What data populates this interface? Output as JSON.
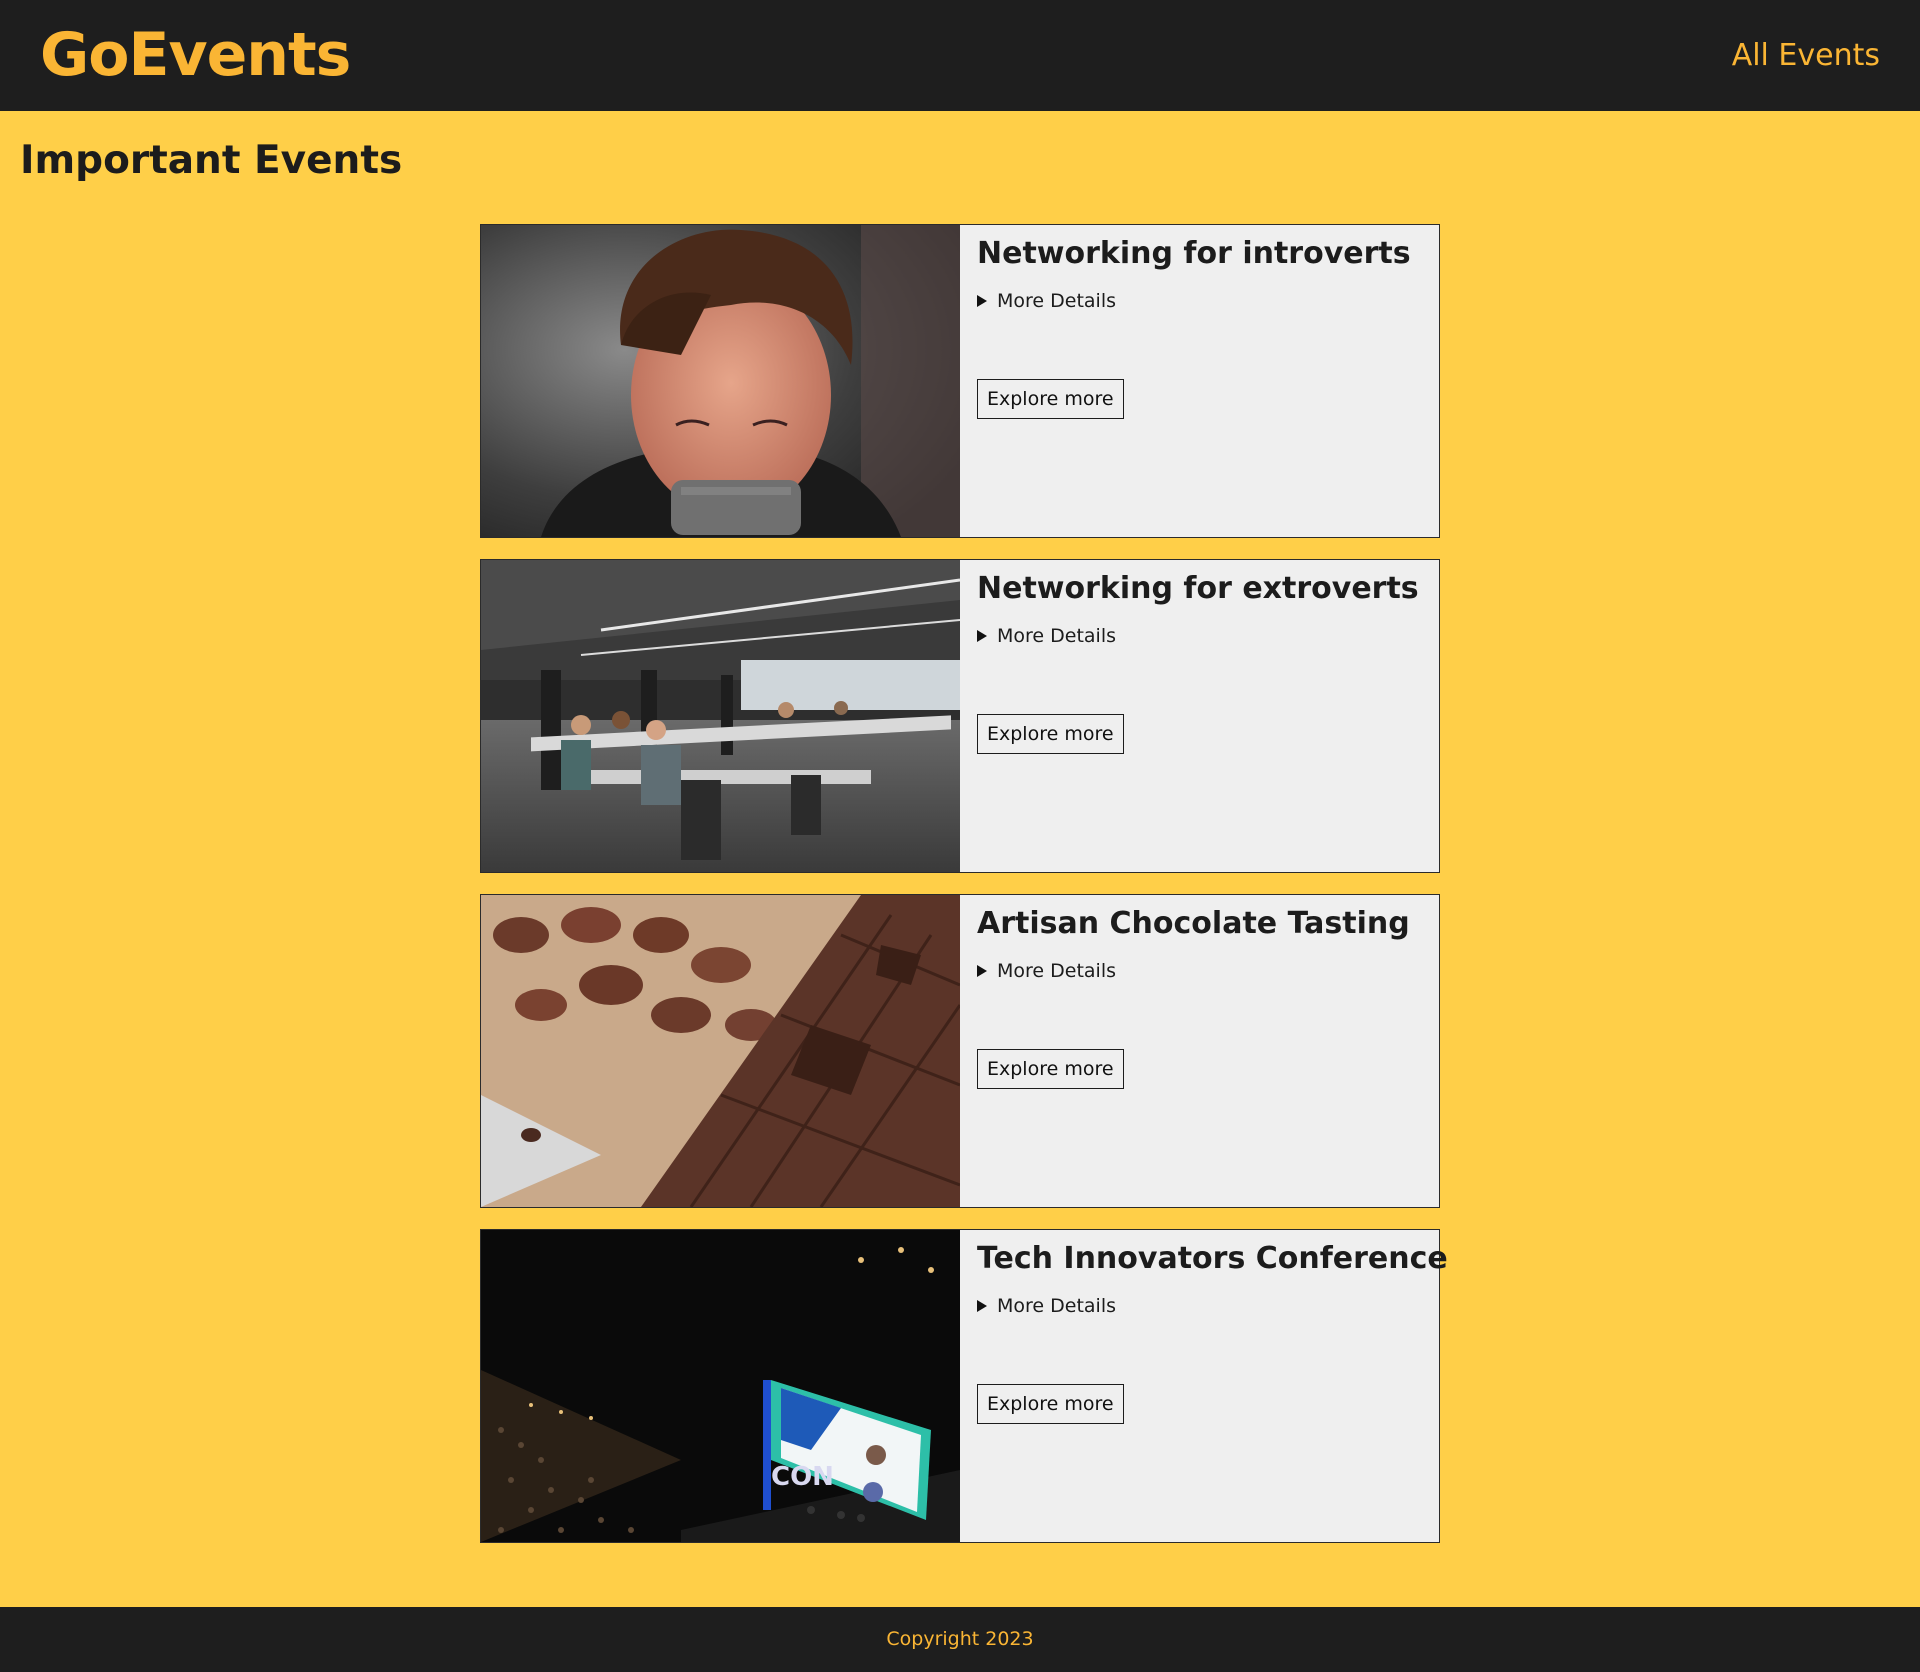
{
  "header": {
    "logo": "GoEvents",
    "nav_all_events": "All Events"
  },
  "main": {
    "title": "Important Events",
    "events": [
      {
        "title": "Networking for introverts",
        "details_label": "More Details",
        "button_label": "Explore more",
        "image": "person-with-taped-mouth-photo"
      },
      {
        "title": "Networking for extroverts",
        "details_label": "More Details",
        "button_label": "Explore more",
        "image": "open-plan-office-photo"
      },
      {
        "title": "Artisan Chocolate Tasting",
        "details_label": "More Details",
        "button_label": "Explore more",
        "image": "chocolate-and-cocoa-beans-photo"
      },
      {
        "title": "Tech Innovators Conference",
        "details_label": "More Details",
        "button_label": "Explore more",
        "image": "conference-auditorium-photo"
      }
    ]
  },
  "footer": {
    "copyright": "Copyright 2023"
  },
  "colors": {
    "page_background": "#ffcf48",
    "bar_background": "#1e1e1e",
    "accent": "#fab534",
    "card_background": "#efefef"
  }
}
